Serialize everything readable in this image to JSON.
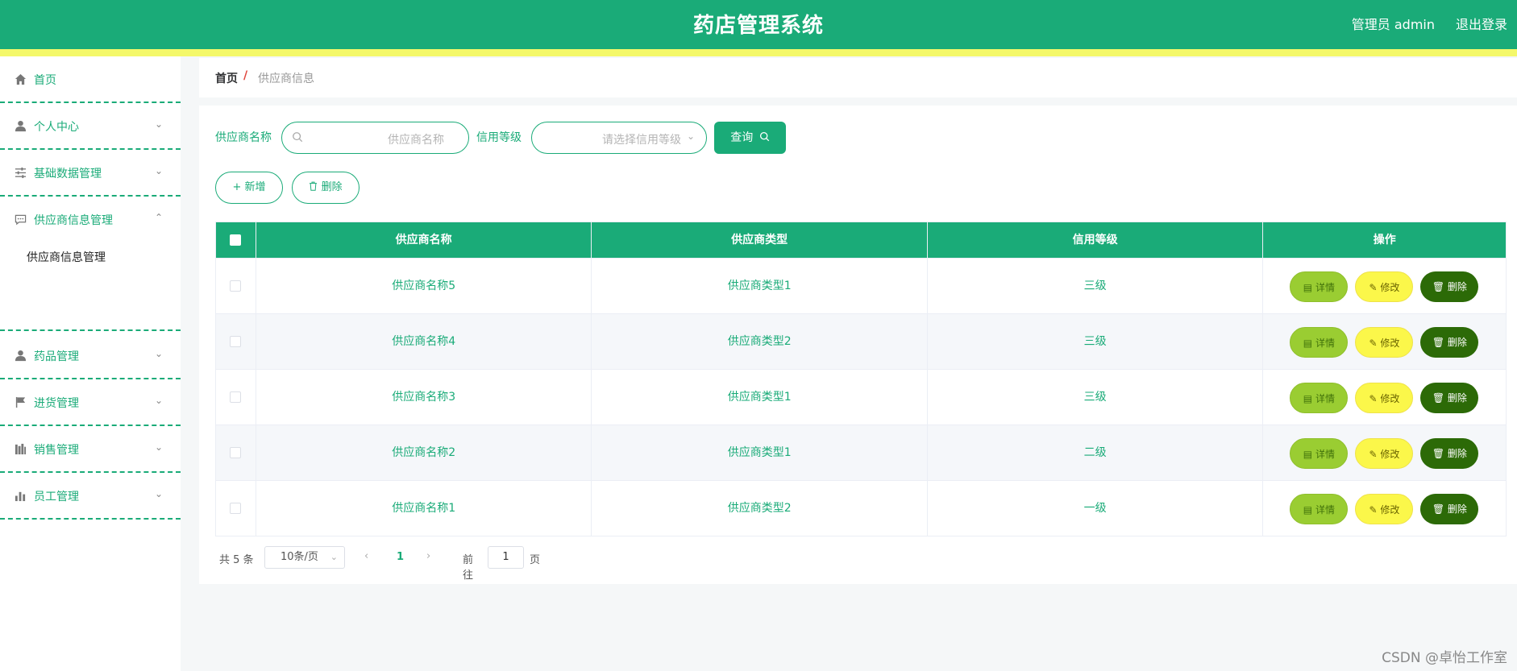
{
  "header": {
    "title": "药店管理系统",
    "user": "管理员 admin",
    "logout": "退出登录"
  },
  "sidebar": {
    "items": [
      {
        "label": "首页",
        "icon": "home-icon"
      },
      {
        "label": "个人中心",
        "icon": "user-icon"
      },
      {
        "label": "基础数据管理",
        "icon": "sliders-icon"
      },
      {
        "label": "供应商信息管理",
        "icon": "chat-icon",
        "expanded": true,
        "children": [
          {
            "label": "供应商信息管理"
          }
        ]
      },
      {
        "label": "药品管理",
        "icon": "user-icon"
      },
      {
        "label": "进货管理",
        "icon": "flag-icon"
      },
      {
        "label": "销售管理",
        "icon": "books-icon"
      },
      {
        "label": "员工管理",
        "icon": "bar-chart-icon"
      }
    ]
  },
  "breadcrumb": {
    "home": "首页",
    "separator": "/",
    "current": "供应商信息"
  },
  "filters": {
    "name_label": "供应商名称",
    "name_placeholder": "供应商名称",
    "credit_label": "信用等级",
    "credit_placeholder": "请选择信用等级",
    "query_button": "查询"
  },
  "actions": {
    "add": "新增",
    "delete": "删除"
  },
  "table": {
    "columns": [
      "供应商名称",
      "供应商类型",
      "信用等级",
      "操作"
    ],
    "rows": [
      {
        "name": "供应商名称5",
        "type": "供应商类型1",
        "credit": "三级"
      },
      {
        "name": "供应商名称4",
        "type": "供应商类型2",
        "credit": "三级"
      },
      {
        "name": "供应商名称3",
        "type": "供应商类型1",
        "credit": "三级"
      },
      {
        "name": "供应商名称2",
        "type": "供应商类型1",
        "credit": "二级"
      },
      {
        "name": "供应商名称1",
        "type": "供应商类型2",
        "credit": "一级"
      }
    ],
    "row_actions": {
      "detail": "详情",
      "edit": "修改",
      "delete": "删除"
    }
  },
  "pagination": {
    "total": "共 5 条",
    "page_size": "10条/页",
    "current_page": "1",
    "goto_label": "前往",
    "goto_value": "1",
    "page_suffix": "页"
  },
  "watermark": "CSDN @卓怡工作室",
  "colors": {
    "primary": "#1aab78",
    "accent_bar": "#f4f86a",
    "detail": "#9acd32",
    "edit": "#fbf74a",
    "delete": "#2c6a07"
  }
}
